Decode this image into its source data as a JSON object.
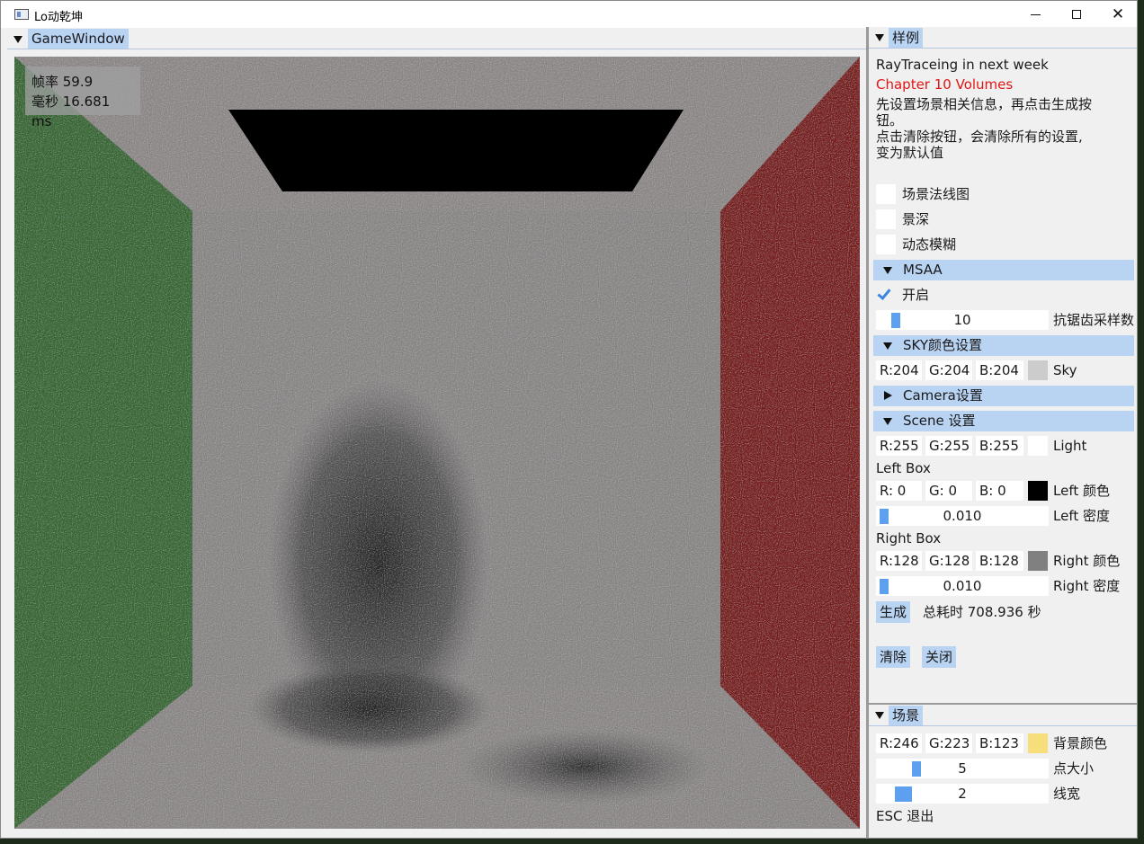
{
  "window": {
    "title": "Lo动乾坤"
  },
  "game_window": {
    "tab_label": "GameWindow",
    "stats": {
      "fps_label": "帧率 59.9",
      "ms_label": "毫秒 16.681 ms"
    }
  },
  "sample_panel": {
    "title": "样例",
    "line1": "RayTraceing in next week",
    "line2": "Chapter 10 Volumes",
    "line3a": "先设置场景相关信息，再点击生成按",
    "line3b": "钮。",
    "line4a": "点击清除按钮，会清除所有的设置,",
    "line4b": "变为默认值",
    "checkboxes": {
      "scene_normal": {
        "label": "场景法线图",
        "checked": false
      },
      "dof": {
        "label": "景深",
        "checked": false
      },
      "motion_blur": {
        "label": "动态模糊",
        "checked": false
      }
    },
    "msaa": {
      "header": "MSAA",
      "enable_label": "开启",
      "enabled": true,
      "samples_value": "10",
      "samples_label": "抗锯齿采样数"
    },
    "sky": {
      "header": "SKY颜色设置",
      "r": "R:204",
      "g": "G:204",
      "b": "B:204",
      "color": "#cccccc",
      "label": "Sky"
    },
    "camera": {
      "header": "Camera设置",
      "collapsed": true
    },
    "scene": {
      "header": "Scene 设置",
      "light": {
        "r": "R:255",
        "g": "G:255",
        "b": "B:255",
        "color": "#ffffff",
        "label": "Light"
      },
      "left_box": {
        "title": "Left Box",
        "r": "R:  0",
        "g": "G:  0",
        "b": "B:  0",
        "color": "#000000",
        "color_label": "Left 颜色",
        "density_value": "0.010",
        "density_label": "Left 密度"
      },
      "right_box": {
        "title": "Right Box",
        "r": "R:128",
        "g": "G:128",
        "b": "B:128",
        "color": "#808080",
        "color_label": "Right 颜色",
        "density_value": "0.010",
        "density_label": "Right 密度"
      },
      "generate_button": "生成",
      "total_time": "总耗时 708.936 秒",
      "clear_button": "清除",
      "close_button": "关闭"
    }
  },
  "scene_panel": {
    "title": "场景",
    "bg": {
      "r": "R:246",
      "g": "G:223",
      "b": "B:123",
      "color": "#f6df7b",
      "label": "背景颜色"
    },
    "point_size": {
      "value": "5",
      "label": "点大小"
    },
    "line_width": {
      "value": "2",
      "label": "线宽"
    },
    "exit_hint": "ESC 退出"
  }
}
